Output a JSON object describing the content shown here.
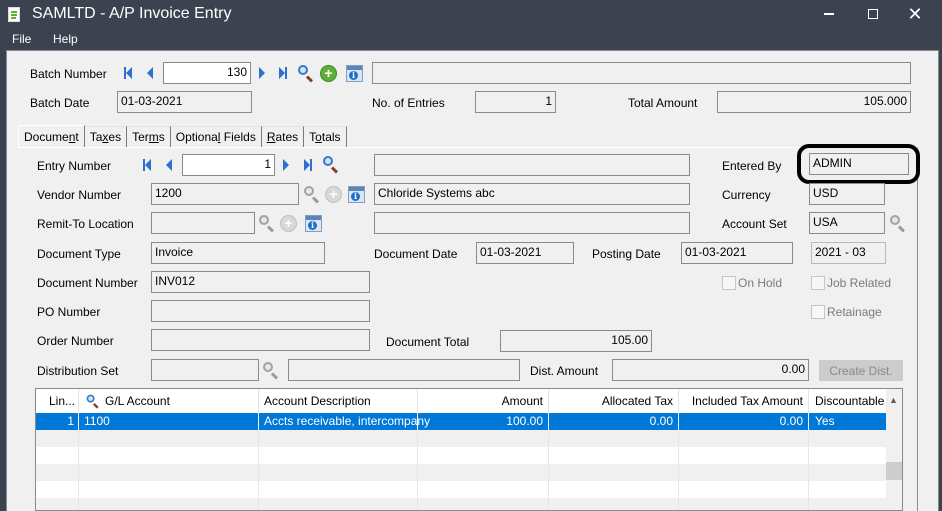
{
  "window": {
    "title": "SAMLTD - A/P Invoice Entry",
    "icon": "document-icon",
    "controls": [
      "minimize",
      "maximize",
      "close"
    ]
  },
  "menu": {
    "items": [
      "File",
      "Help"
    ]
  },
  "header": {
    "batch_number_label": "Batch Number",
    "batch_number": "130",
    "batch_description": "",
    "batch_date_label": "Batch Date",
    "batch_date": "01-03-2021",
    "entries_label": "No. of Entries",
    "entries": "1",
    "total_amount_label": "Total Amount",
    "total_amount": "105.000"
  },
  "tabs": [
    {
      "label": "Document",
      "mnemonic": "n",
      "active": true
    },
    {
      "label": "Taxes",
      "mnemonic": "x"
    },
    {
      "label": "Terms",
      "mnemonic": "m"
    },
    {
      "label": "Optional Fields",
      "mnemonic": "l"
    },
    {
      "label": "Rates",
      "mnemonic": "R"
    },
    {
      "label": "Totals",
      "mnemonic": "o"
    }
  ],
  "document": {
    "entry_number_label": "Entry Number",
    "entry_number": "1",
    "entry_description": "",
    "entered_by_label": "Entered By",
    "entered_by": "ADMIN",
    "vendor_number_label": "Vendor Number",
    "vendor_number": "1200",
    "vendor_name": "Chloride Systems abc",
    "currency_label": "Currency",
    "currency": "USD",
    "remit_to_label": "Remit-To Location",
    "remit_to": "",
    "remit_to_description": "",
    "account_set_label": "Account Set",
    "account_set": "USA",
    "document_type_label": "Document Type",
    "document_type": "Invoice",
    "document_date_label": "Document Date",
    "document_date": "01-03-2021",
    "posting_date_label": "Posting Date",
    "posting_date": "01-03-2021",
    "fiscal_period": "2021 - 03",
    "document_number_label": "Document Number",
    "document_number": "INV012",
    "on_hold_label": "On Hold",
    "on_hold": false,
    "job_related_label": "Job Related",
    "job_related": false,
    "po_number_label": "PO Number",
    "po_number": "",
    "retainage_label": "Retainage",
    "retainage": false,
    "order_number_label": "Order Number",
    "order_number": "",
    "document_total_label": "Document Total",
    "document_total": "105.00",
    "distribution_set_label": "Distribution Set",
    "distribution_set": "",
    "distribution_set_description": "",
    "dist_amount_label": "Dist. Amount",
    "dist_amount": "0.00",
    "create_dist_label": "Create Dist."
  },
  "grid": {
    "columns": [
      "Lin...",
      "G/L Account",
      "Account Description",
      "Amount",
      "Allocated Tax",
      "Included Tax Amount",
      "Discountable"
    ],
    "rows": [
      {
        "line": "1",
        "gl_account": "1100",
        "description": "Accts receivable, intercompany",
        "amount": "100.00",
        "allocated_tax": "0.00",
        "included_tax": "0.00",
        "discountable": "Yes",
        "selected": true
      }
    ]
  },
  "colors": {
    "titlebar": "#3c4250",
    "selection": "#0078d7",
    "panel": "#f0f0f0",
    "disabled_button": "#cccccc"
  }
}
